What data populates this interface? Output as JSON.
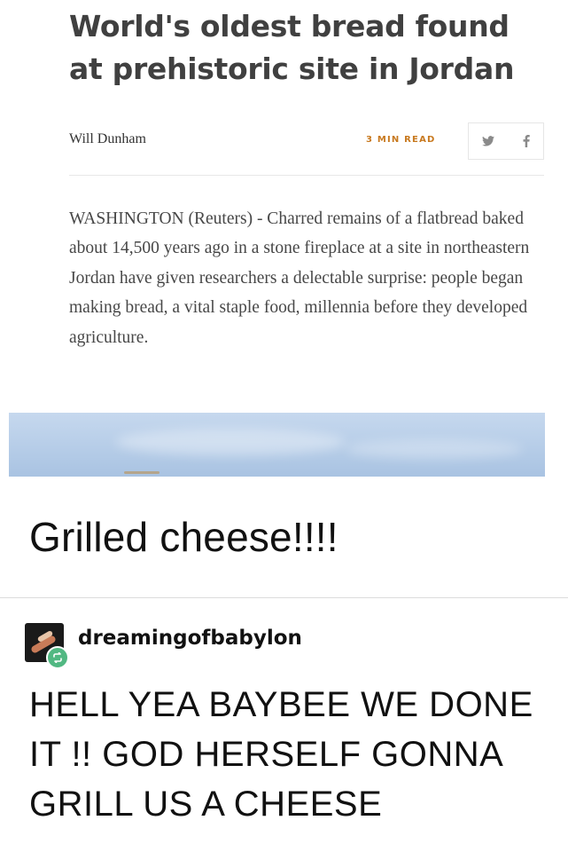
{
  "article": {
    "headline": "World's oldest bread found at prehistoric site in Jordan",
    "author": "Will Dunham",
    "read_time": "3 MIN READ",
    "share": {
      "twitter_icon": "twitter-icon",
      "facebook_icon": "facebook-icon"
    },
    "body": "WASHINGTON (Reuters) - Charred remains of a flatbread baked about 14,500 years ago in a stone fireplace at a site in northeastern Jordan have given researchers a delectable surprise: people began making bread, a vital staple food, millennia before they developed agriculture."
  },
  "comment1": {
    "text": "Grilled cheese!!!!"
  },
  "reblog": {
    "username": "dreamingofbabylon",
    "badge_icon": "reblog-icon",
    "badge_color": "#51b882",
    "text": "HELL YEA BAYBEE WE DONE IT !! GOD HERSELF GONNA GRILL US A CHEESE"
  },
  "colors": {
    "accent": "#c8791f",
    "headline": "#404040",
    "body": "#474747"
  }
}
